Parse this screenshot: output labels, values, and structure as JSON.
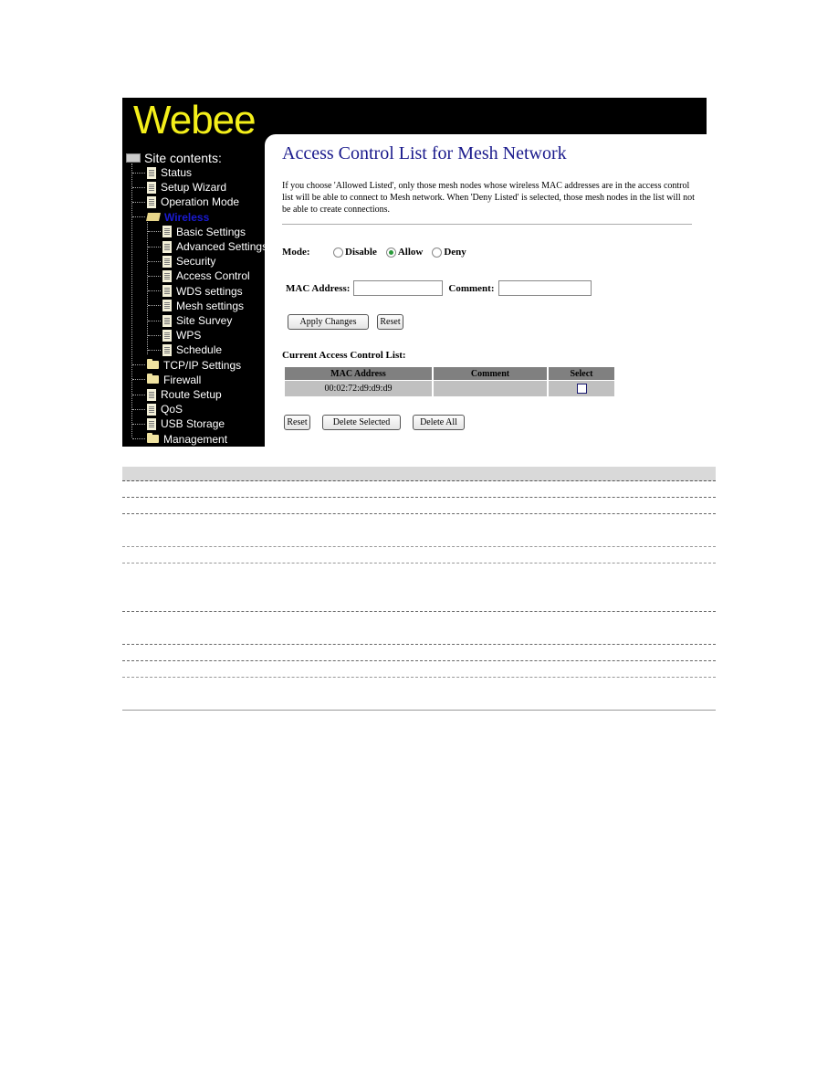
{
  "app": {
    "logo_text": "Webee"
  },
  "sidebar": {
    "root_label": "Site contents:",
    "items": [
      {
        "label": "Status",
        "icon": "document-icon",
        "level": 1
      },
      {
        "label": "Setup Wizard",
        "icon": "document-icon",
        "level": 1
      },
      {
        "label": "Operation Mode",
        "icon": "document-icon",
        "level": 1
      },
      {
        "label": "Wireless",
        "icon": "folder-open-icon",
        "level": 1,
        "active": true
      },
      {
        "label": "Basic Settings",
        "icon": "document-icon",
        "level": 2
      },
      {
        "label": "Advanced Settings",
        "icon": "document-icon",
        "level": 2
      },
      {
        "label": "Security",
        "icon": "document-icon",
        "level": 2
      },
      {
        "label": "Access Control",
        "icon": "document-icon",
        "level": 2
      },
      {
        "label": "WDS settings",
        "icon": "document-icon",
        "level": 2
      },
      {
        "label": "Mesh settings",
        "icon": "document-icon",
        "level": 2
      },
      {
        "label": "Site Survey",
        "icon": "document-icon",
        "level": 2
      },
      {
        "label": "WPS",
        "icon": "document-icon",
        "level": 2
      },
      {
        "label": "Schedule",
        "icon": "document-icon",
        "level": 2
      },
      {
        "label": "TCP/IP Settings",
        "icon": "folder-icon",
        "level": 1
      },
      {
        "label": "Firewall",
        "icon": "folder-icon",
        "level": 1
      },
      {
        "label": "Route Setup",
        "icon": "document-icon",
        "level": 1
      },
      {
        "label": "QoS",
        "icon": "document-icon",
        "level": 1
      },
      {
        "label": "USB Storage",
        "icon": "document-icon",
        "level": 1
      },
      {
        "label": "Management",
        "icon": "folder-icon",
        "level": 1
      }
    ]
  },
  "main": {
    "title": "Access Control List for Mesh Network",
    "description": "If you choose 'Allowed Listed', only those mesh nodes whose wireless MAC addresses are in the access control list will be able to connect to Mesh network. When 'Deny Listed' is selected, those mesh nodes in the list will not be able to create connections.",
    "mode": {
      "label": "Mode:",
      "options": [
        {
          "label": "Disable",
          "checked": false
        },
        {
          "label": "Allow",
          "checked": true
        },
        {
          "label": "Deny",
          "checked": false
        }
      ]
    },
    "mac_address": {
      "label": "MAC Address:",
      "value": ""
    },
    "comment": {
      "label": "Comment:",
      "value": ""
    },
    "buttons": {
      "apply": "Apply Changes",
      "reset": "Reset",
      "reset_list": "Reset",
      "delete_selected": "Delete Selected",
      "delete_all": "Delete All"
    },
    "list": {
      "title": "Current Access Control List:",
      "columns": [
        "MAC Address",
        "Comment",
        "Select"
      ],
      "rows": [
        {
          "mac": "00:02:72:d9:d9:d9",
          "comment": "",
          "selected": false
        }
      ]
    }
  },
  "colors": {
    "logo": "#f4ef1a",
    "title": "#1a1a8c",
    "active_nav": "#1a1ad0",
    "table_header": "#808080",
    "table_row": "#c0c0c0",
    "radio_checked": "#2a9a3a"
  }
}
